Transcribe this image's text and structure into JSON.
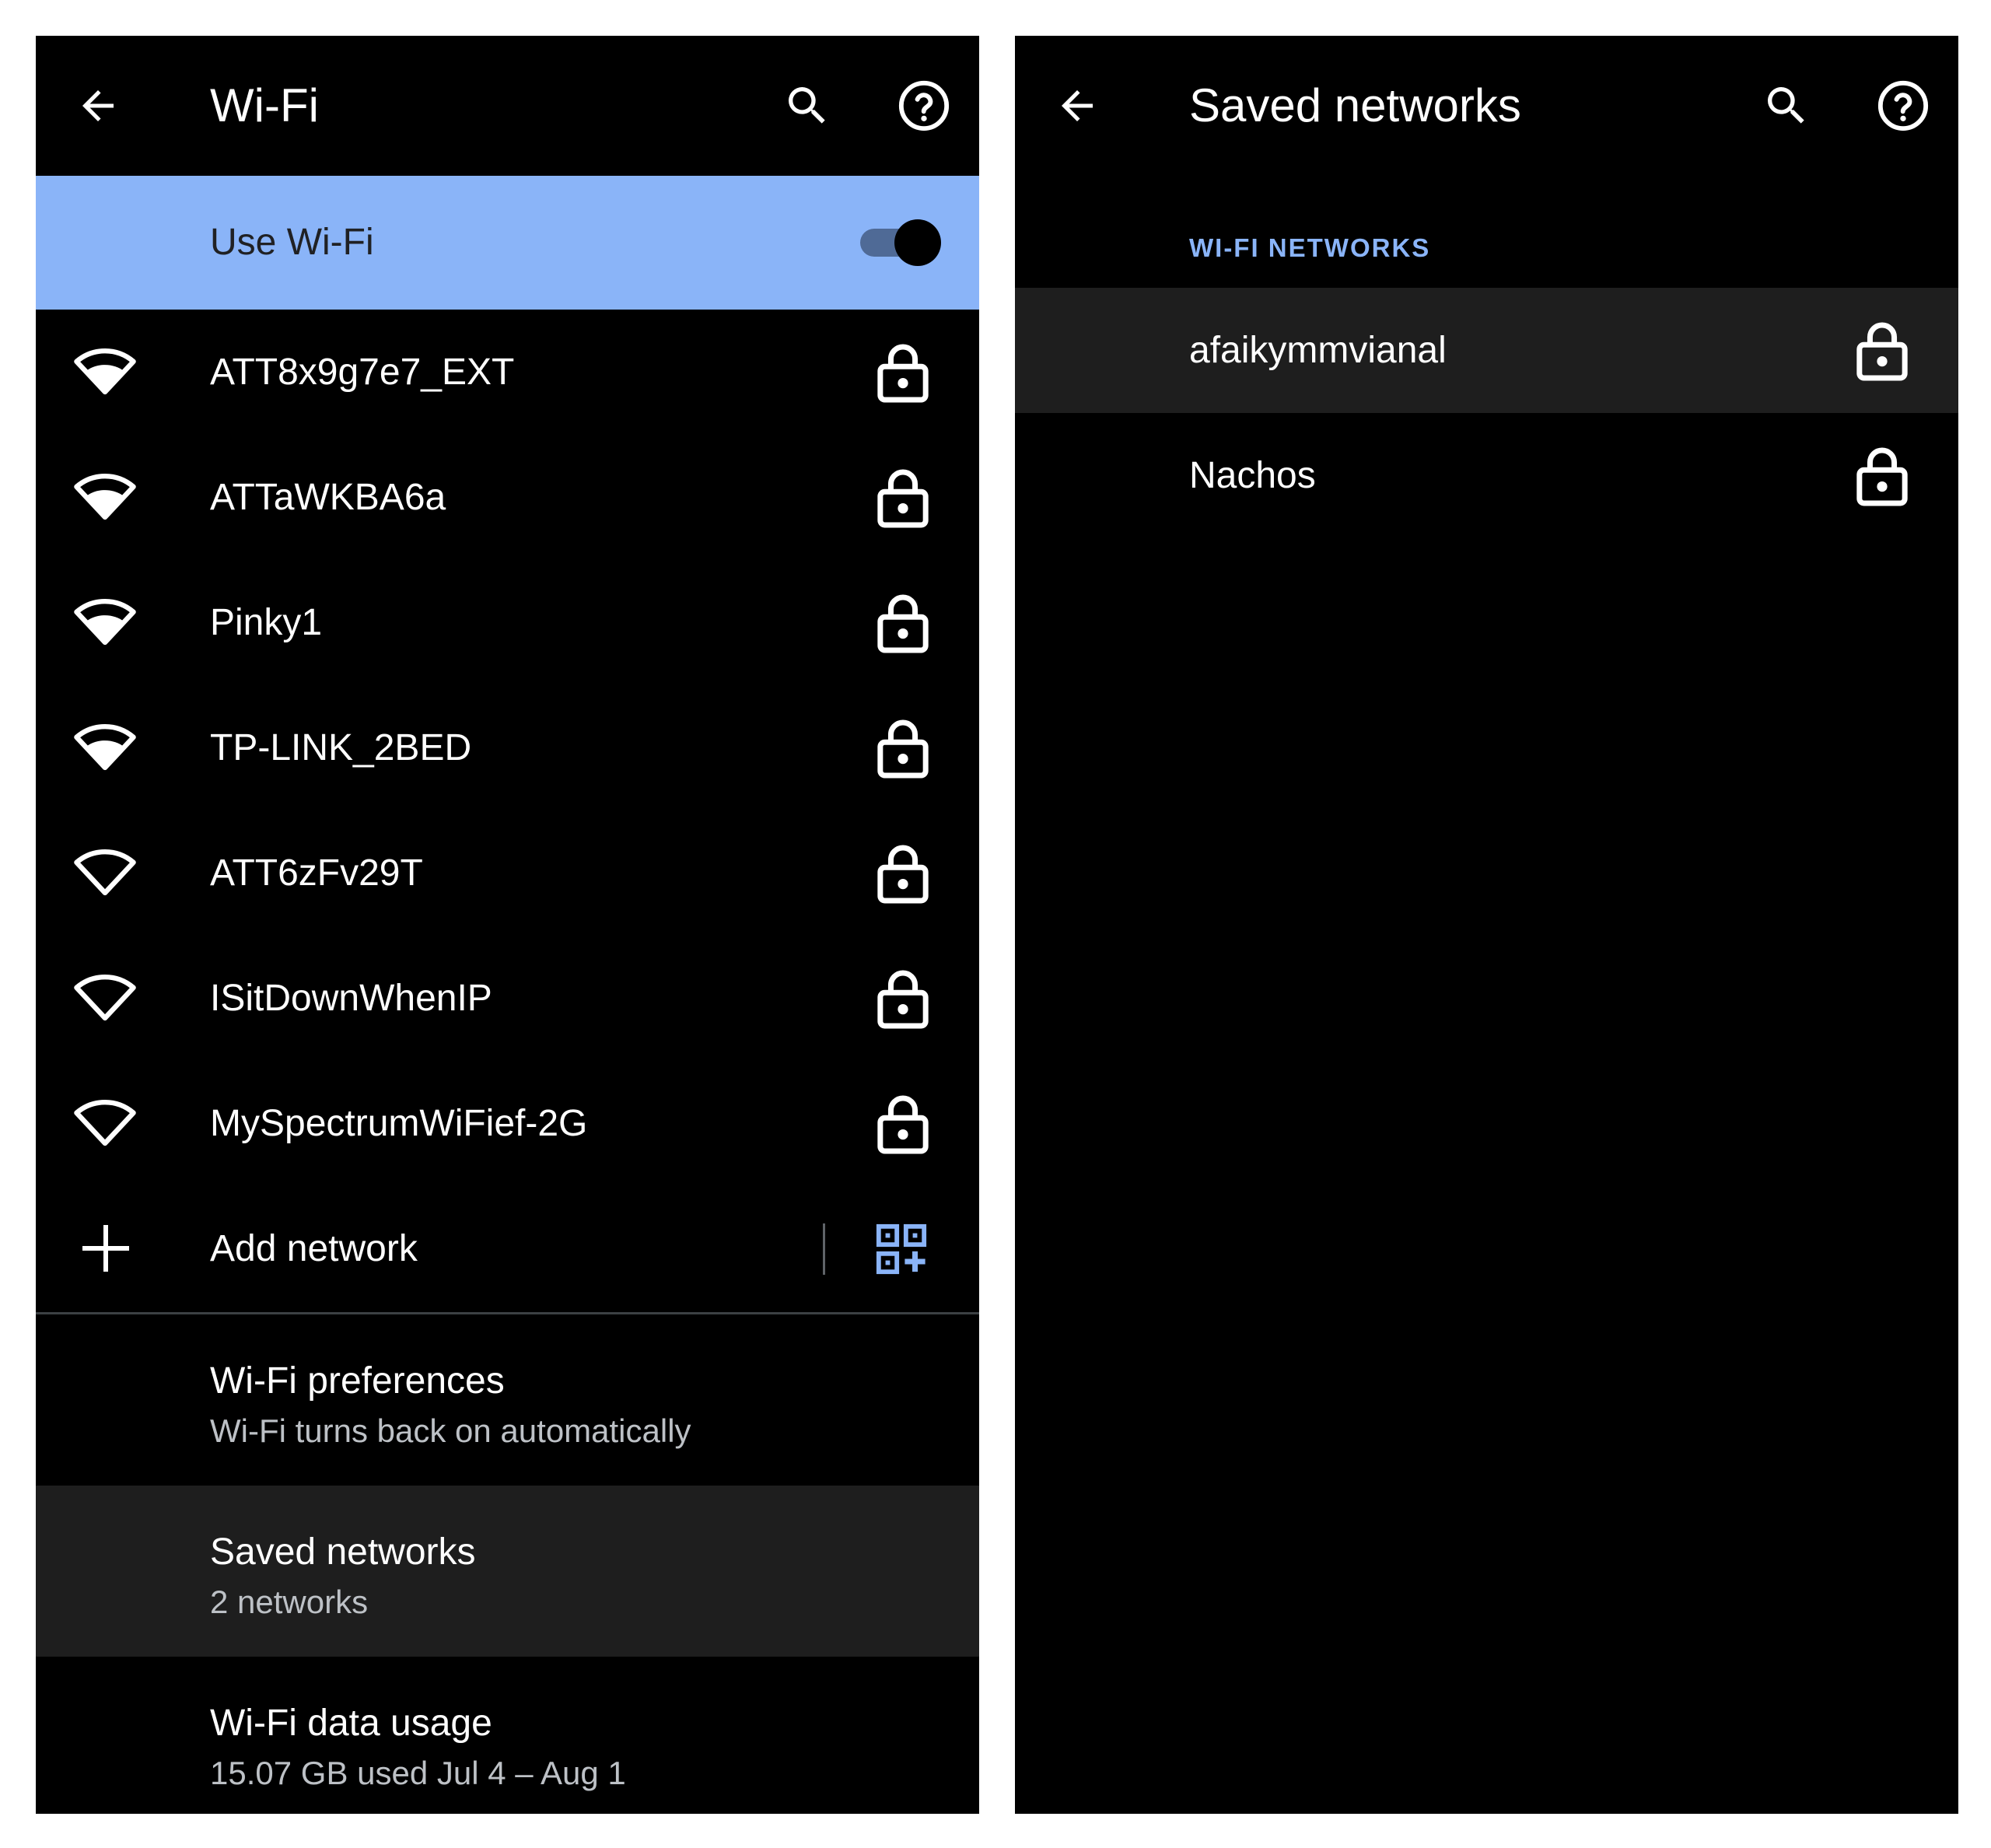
{
  "colors": {
    "panel_bg": "#000000",
    "accent": "#8ab4f8",
    "highlight_row": "#1e1e1e",
    "secondary_text": "#bdc1c6"
  },
  "wifi_screen": {
    "back_icon": "arrow-back-icon",
    "title": "Wi-Fi",
    "search_icon": "search-icon",
    "help_icon": "help-circle-icon",
    "use_wifi": {
      "label": "Use Wi-Fi",
      "enabled": true
    },
    "networks": [
      {
        "name": "ATT8x9g7e7_EXT",
        "signal_icon": "wifi-signal-icon",
        "secured": true
      },
      {
        "name": "ATTaWKBA6a",
        "signal_icon": "wifi-signal-icon",
        "secured": true
      },
      {
        "name": "Pinky1",
        "signal_icon": "wifi-signal-icon",
        "secured": true
      },
      {
        "name": "TP-LINK_2BED",
        "signal_icon": "wifi-signal-icon",
        "secured": true
      },
      {
        "name": "ATT6zFv29T",
        "signal_icon": "wifi-signal-empty-icon",
        "secured": true
      },
      {
        "name": "ISitDownWhenIP",
        "signal_icon": "wifi-signal-empty-icon",
        "secured": true
      },
      {
        "name": "MySpectrumWiFief-2G",
        "signal_icon": "wifi-signal-empty-icon",
        "secured": true
      }
    ],
    "add_network": {
      "label": "Add network",
      "plus_icon": "plus-icon",
      "qr_icon": "qr-code-scan-icon"
    },
    "preferences": [
      {
        "title": "Wi-Fi preferences",
        "subtitle": "Wi-Fi turns back on automatically"
      },
      {
        "title": "Saved networks",
        "subtitle": "2 networks"
      },
      {
        "title": "Wi-Fi data usage",
        "subtitle": "15.07 GB used Jul 4 – Aug 1"
      }
    ]
  },
  "saved_screen": {
    "back_icon": "arrow-back-icon",
    "title": "Saved networks",
    "search_icon": "search-icon",
    "help_icon": "help-circle-icon",
    "section_header": "WI-FI NETWORKS",
    "networks": [
      {
        "name": "afaikymmvianal",
        "secured": true
      },
      {
        "name": "Nachos",
        "secured": true
      }
    ]
  }
}
